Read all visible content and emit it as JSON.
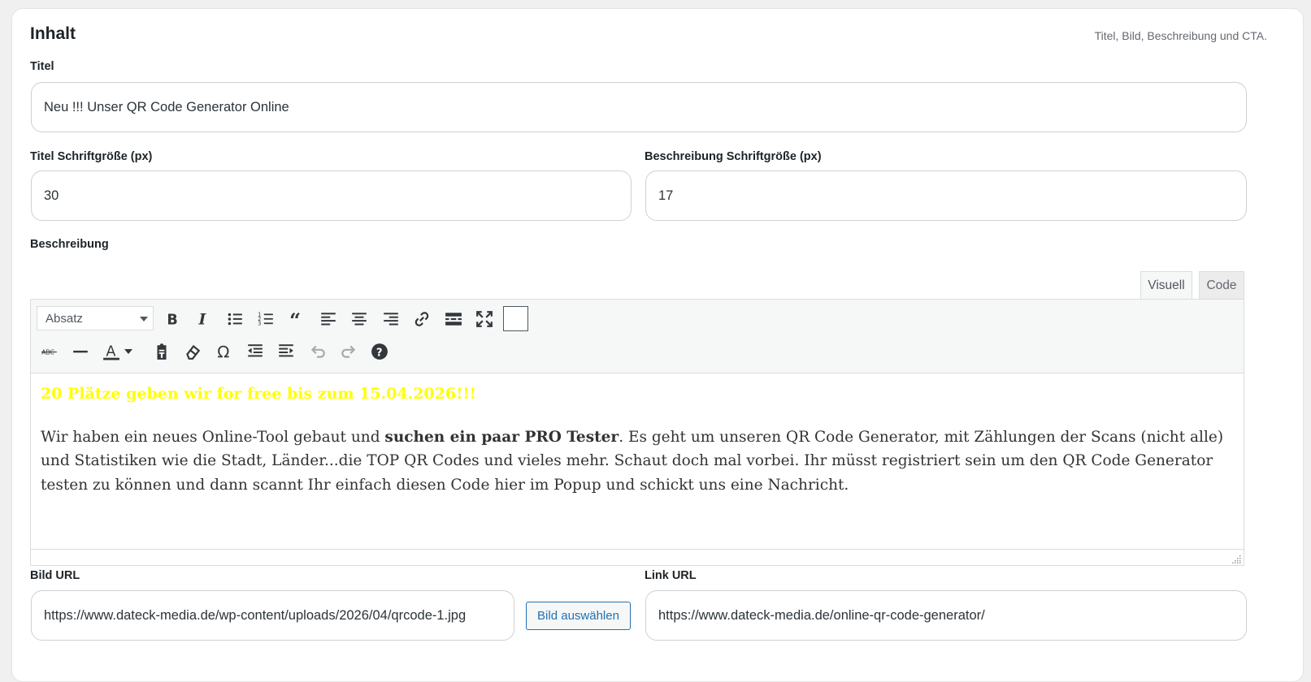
{
  "section": {
    "title": "Inhalt",
    "subtitle": "Titel, Bild, Beschreibung und CTA."
  },
  "fields": {
    "title_label": "Titel",
    "title_value": "Neu !!! Unser QR Code Generator Online",
    "title_font_label": "Titel Schriftgröße (px)",
    "title_font_value": "30",
    "desc_font_label": "Beschreibung Schriftgröße (px)",
    "desc_font_value": "17",
    "description_label": "Beschreibung",
    "image_label": "Bild URL",
    "image_value": "https://www.dateck-media.de/wp-content/uploads/2026/04/qrcode-1.jpg",
    "choose_image_button": "Bild auswählen",
    "link_label": "Link URL",
    "link_value": "https://www.dateck-media.de/online-qr-code-generator/"
  },
  "editor": {
    "tabs": {
      "visual": "Visuell",
      "code": "Code"
    },
    "format_select": "Absatz",
    "toolbar_row1": [
      "bold-icon",
      "italic-icon",
      "bullet-list-icon",
      "numbered-list-icon",
      "blockquote-icon",
      "align-left-icon",
      "align-center-icon",
      "align-right-icon",
      "link-icon",
      "read-more-icon",
      "fullscreen-icon",
      "toolbar-toggle-icon"
    ],
    "toolbar_row2": [
      "strikethrough-icon",
      "horizontal-line-icon",
      "text-color-icon",
      "paste-text-icon",
      "clear-formatting-icon",
      "special-character-icon",
      "outdent-icon",
      "indent-icon",
      "undo-icon",
      "redo-icon",
      "help-icon"
    ],
    "content": {
      "highlight": "20 Plätze geben wir for free  bis zum 15.04.2026!!!",
      "p_before": "Wir haben ein neues Online-Tool gebaut und ",
      "p_bold": "suchen ein paar PRO Tester",
      "p_after": ". Es geht um unseren QR Code Generator, mit Zählungen der Scans (nicht alle) und Statistiken wie die Stadt, Länder...die TOP QR Codes und vieles mehr. Schaut doch mal vorbei. Ihr müsst registriert sein um den QR Code Generator testen zu können und dann scannt Ihr einfach diesen Code hier im Popup und schickt uns eine Nachricht."
    },
    "highlight_color": "#ffff00"
  }
}
